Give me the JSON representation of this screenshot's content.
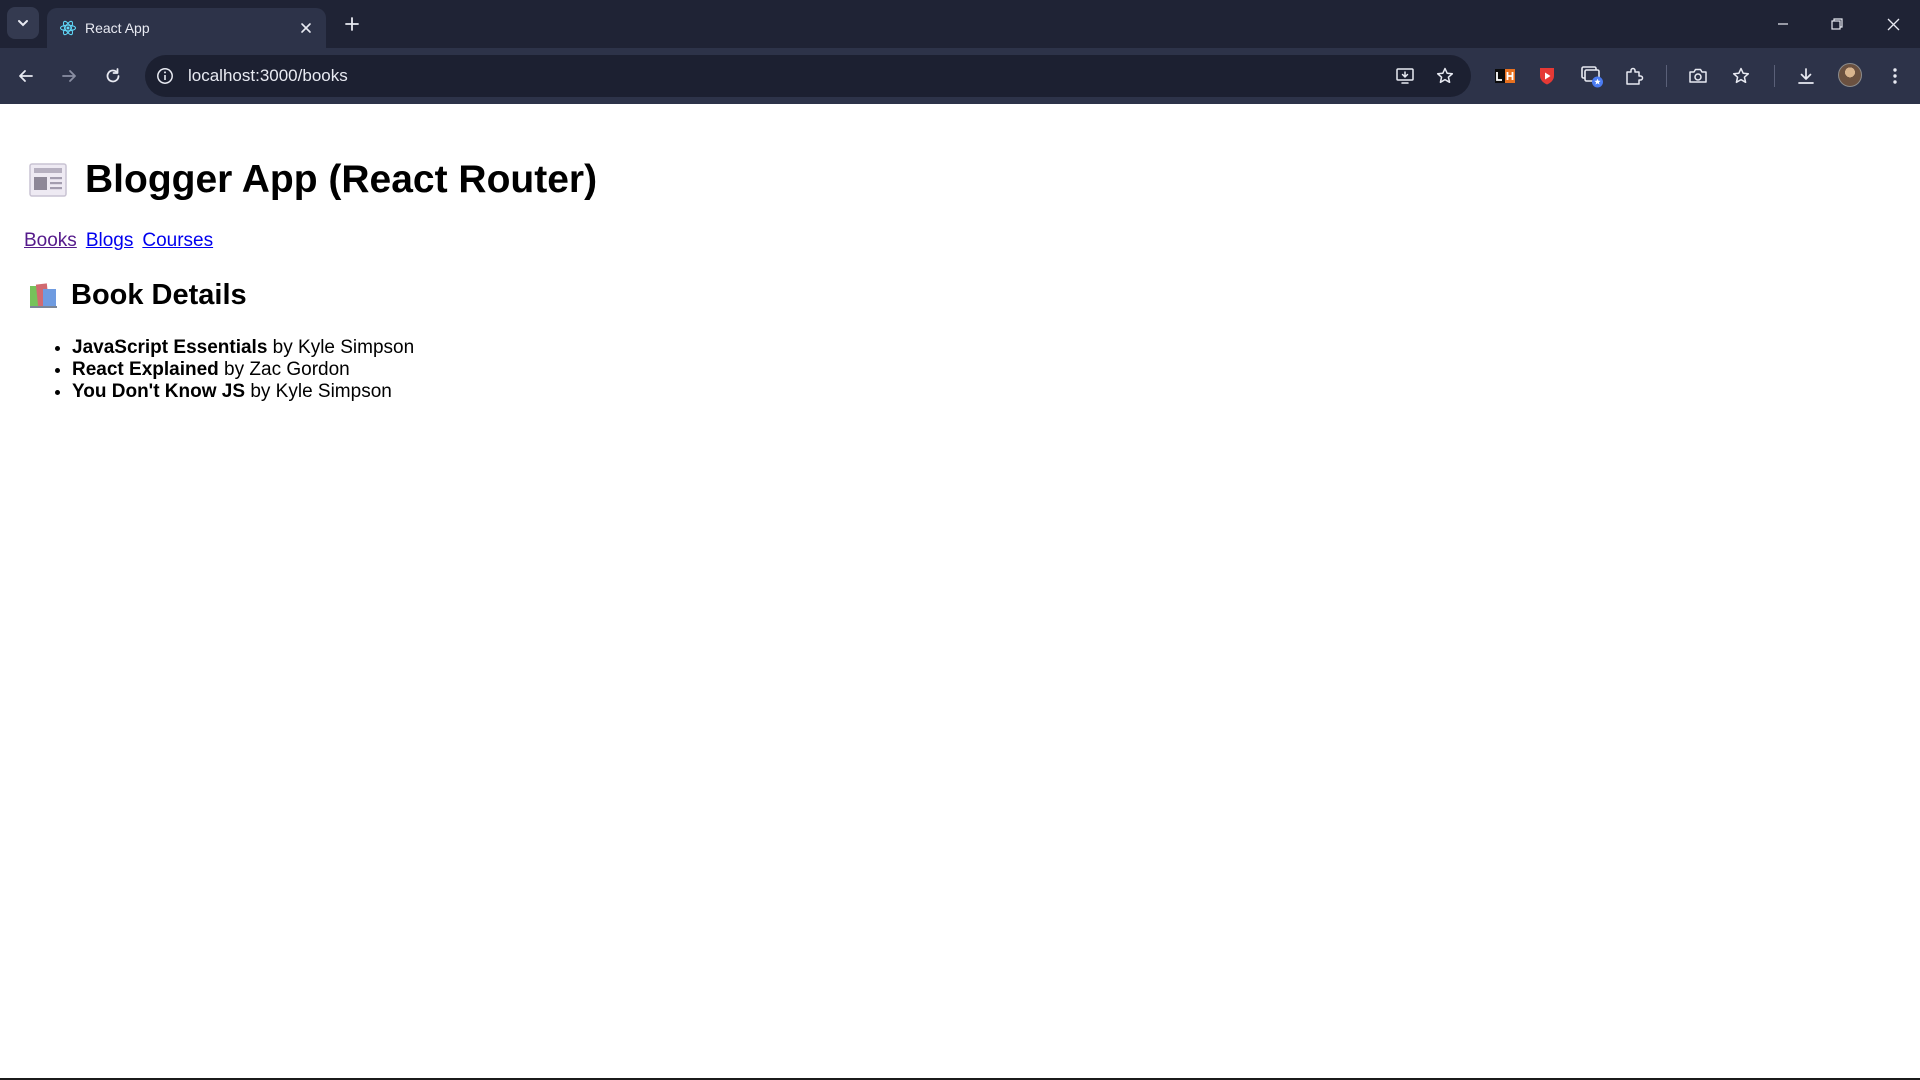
{
  "browser": {
    "tab": {
      "title": "React App",
      "favicon": "react-logo-icon"
    },
    "address_bar": {
      "url": "localhost:3000/books"
    },
    "colors": {
      "frame": "#1f2335",
      "toolbar": "#2d3349",
      "omnibox": "#1c2031"
    }
  },
  "page": {
    "title": "Blogger App (React Router)",
    "title_icon": "newspaper-icon",
    "nav": [
      {
        "label": "Books",
        "state": "visited"
      },
      {
        "label": "Blogs",
        "state": "unvisited"
      },
      {
        "label": "Courses",
        "state": "unvisited"
      }
    ],
    "section_title": "Book Details",
    "section_icon": "books-icon",
    "books": [
      {
        "title": "JavaScript Essentials",
        "byline": " by Kyle Simpson"
      },
      {
        "title": "React Explained",
        "byline": " by Zac Gordon"
      },
      {
        "title": "You Don't Know JS",
        "byline": " by Kyle Simpson"
      }
    ],
    "colors": {
      "link": "#0000ee",
      "visited_link": "#551a8b",
      "text": "#000000"
    }
  }
}
